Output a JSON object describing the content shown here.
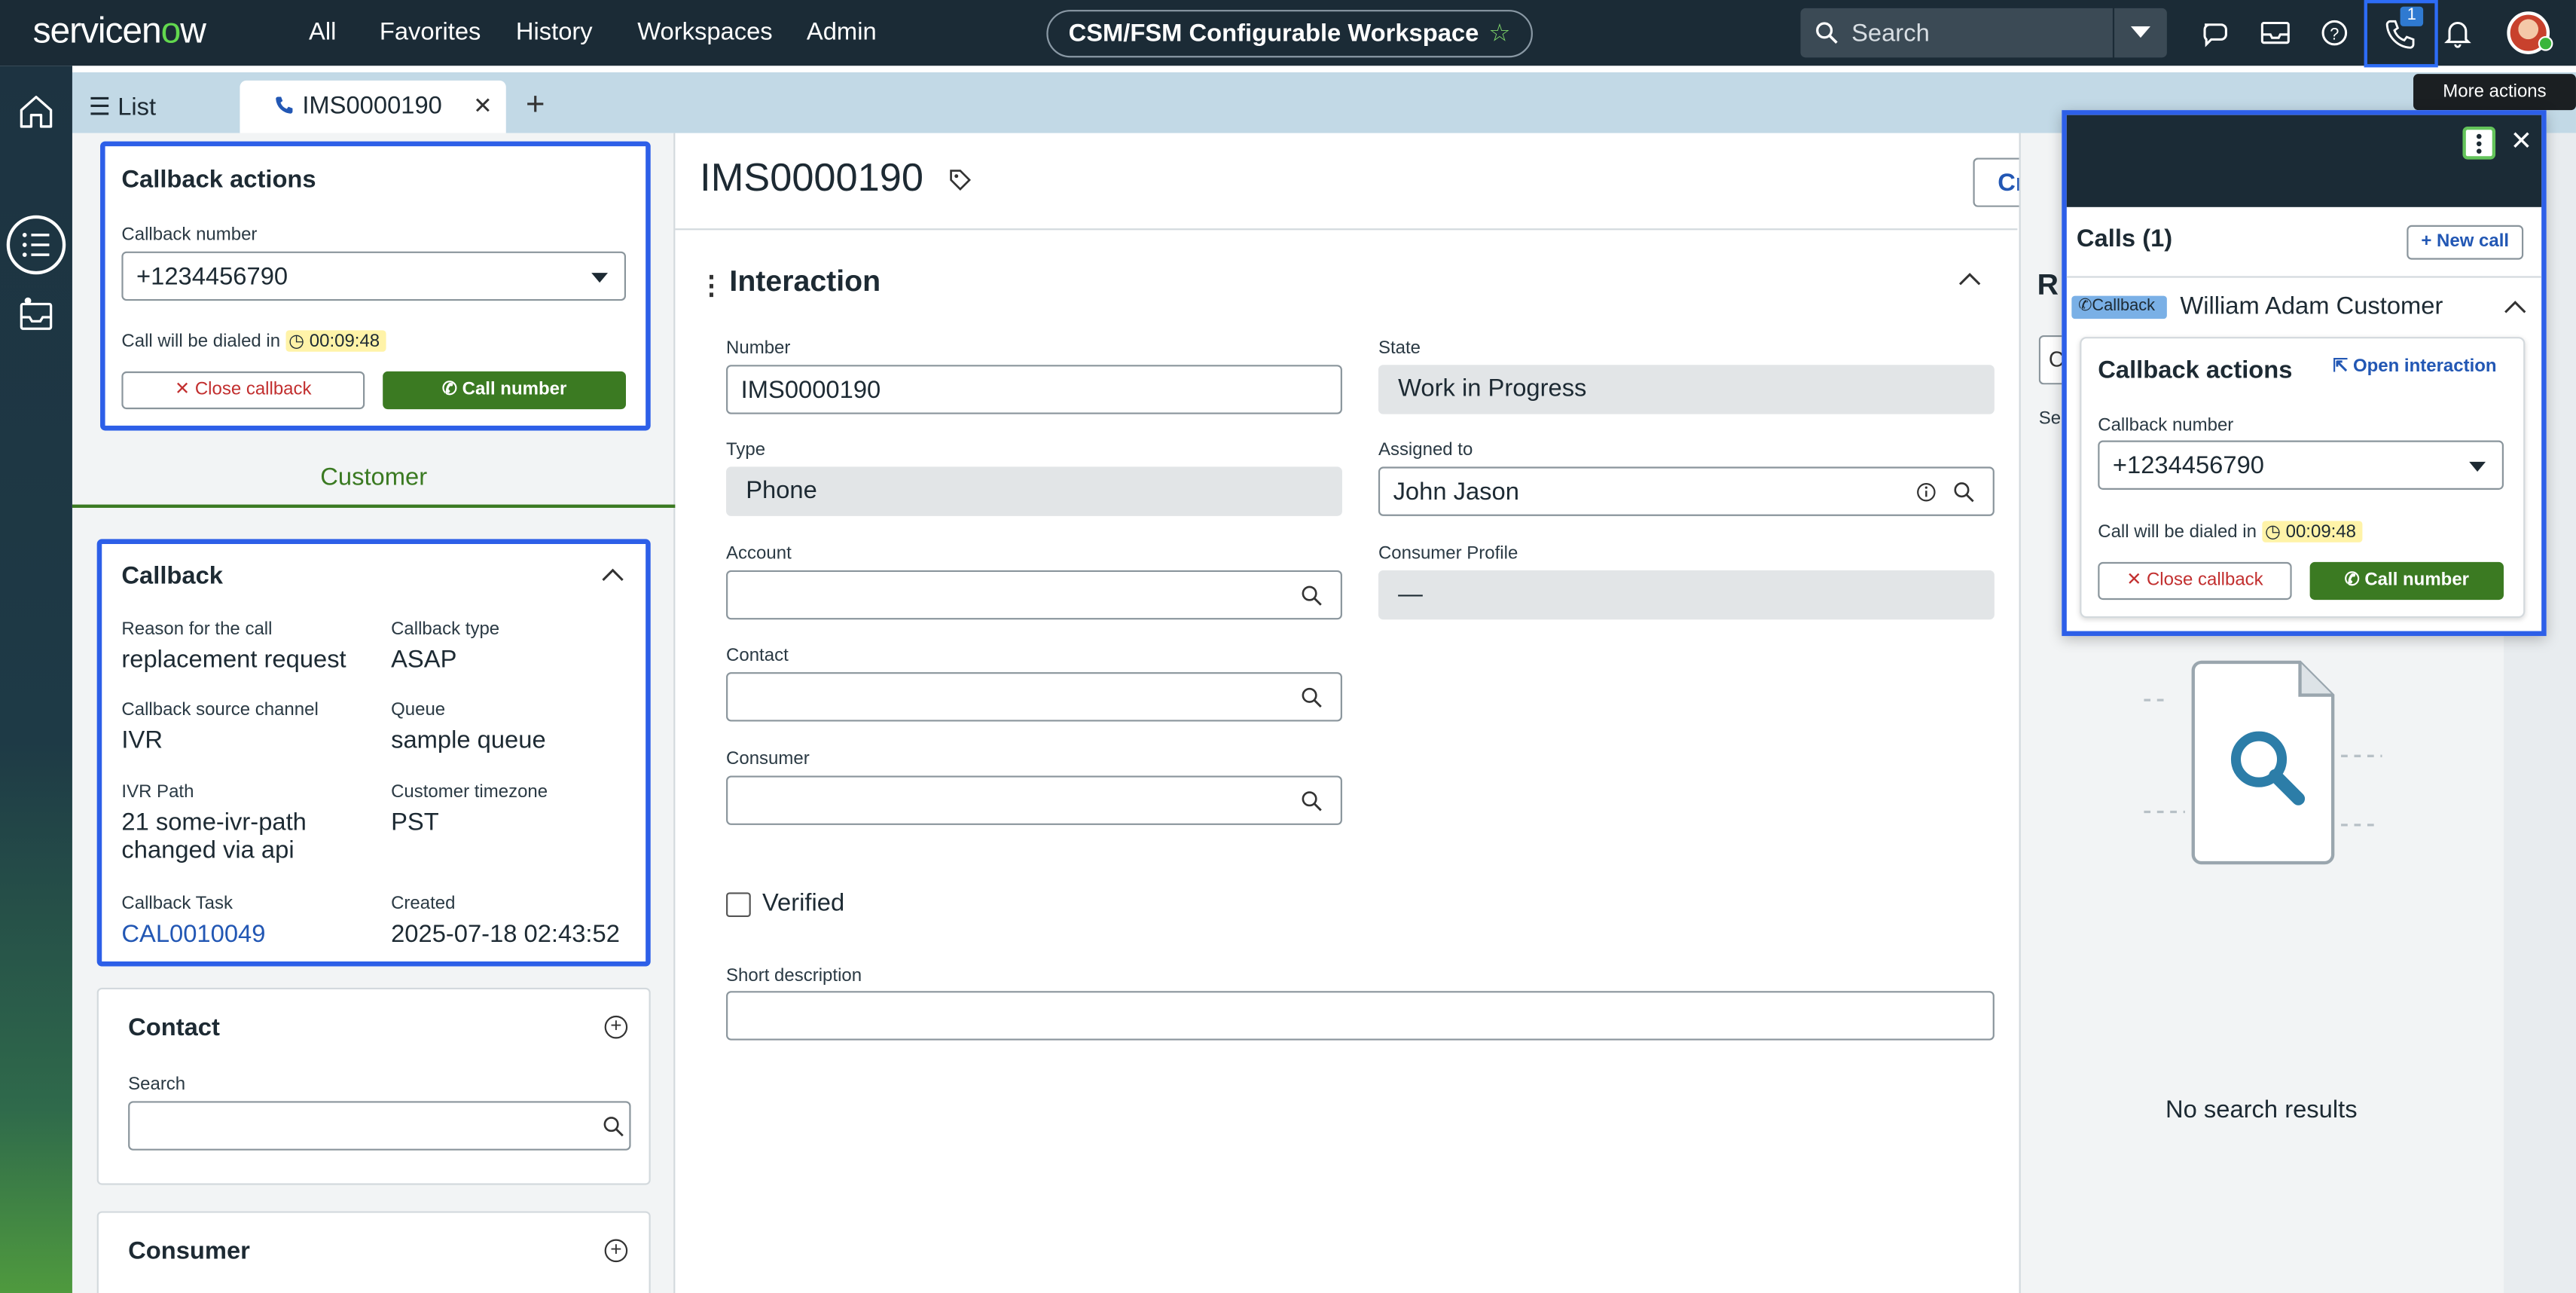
{
  "topnav": {
    "logo": "servicenow",
    "items": [
      "All",
      "Favorites",
      "History",
      "Workspaces",
      "Admin"
    ],
    "workspace": "CSM/FSM Configurable Workspace",
    "search_placeholder": "Search",
    "phone_badge": "1"
  },
  "tabs": {
    "list_label": "List",
    "active_label": "IMS0000190"
  },
  "tooltip": "More actions",
  "callback_actions_left": {
    "title": "Callback actions",
    "number_label": "Callback number",
    "number_value": "+1234456790",
    "dial_text": "Call will be dialed in",
    "timer": "00:09:48",
    "close_label": "Close callback",
    "call_label": "Call number"
  },
  "customer_tab": "Customer",
  "callback_card": {
    "title": "Callback",
    "fields": [
      {
        "label": "Reason for the call",
        "value": "replacement request"
      },
      {
        "label": "Callback type",
        "value": "ASAP"
      },
      {
        "label": "Callback source channel",
        "value": "IVR"
      },
      {
        "label": "Queue",
        "value": "sample queue"
      },
      {
        "label": "IVR Path",
        "value": "21 some-ivr-path changed via api"
      },
      {
        "label": "Customer timezone",
        "value": "PST"
      },
      {
        "label": "Callback Task",
        "value": "CAL0010049"
      },
      {
        "label": "Created",
        "value": "2025-07-18 02:43:52"
      }
    ]
  },
  "contact_card": {
    "title": "Contact",
    "search_label": "Search"
  },
  "consumer_card": {
    "title": "Consumer"
  },
  "main": {
    "title": "IMS0000190",
    "create_label": "Creat",
    "section_title": "Interaction",
    "number_label": "Number",
    "number_value": "IMS0000190",
    "state_label": "State",
    "state_value": "Work in Progress",
    "type_label": "Type",
    "type_value": "Phone",
    "assigned_label": "Assigned to",
    "assigned_value": "John Jason",
    "account_label": "Account",
    "consumer_profile_label": "Consumer Profile",
    "consumer_profile_value": "—",
    "contact_label": "Contact",
    "consumer_label": "Consumer",
    "verified_label": "Verified",
    "short_desc_label": "Short description"
  },
  "right_panel": {
    "heading_fragment": "R",
    "box_fragment": "C",
    "label_fragment": "Se",
    "no_results": "No search results"
  },
  "calls_popover": {
    "title": "Calls (1)",
    "new_call": "New call",
    "badge": "Callback",
    "caller": "William Adam Customer",
    "card_title": "Callback actions",
    "open_interaction": "Open interaction",
    "number_label": "Callback number",
    "number_value": "+1234456790",
    "dial_text": "Call will be dialed in",
    "timer": "00:09:48",
    "close_label": "Close callback",
    "call_label": "Call number"
  }
}
